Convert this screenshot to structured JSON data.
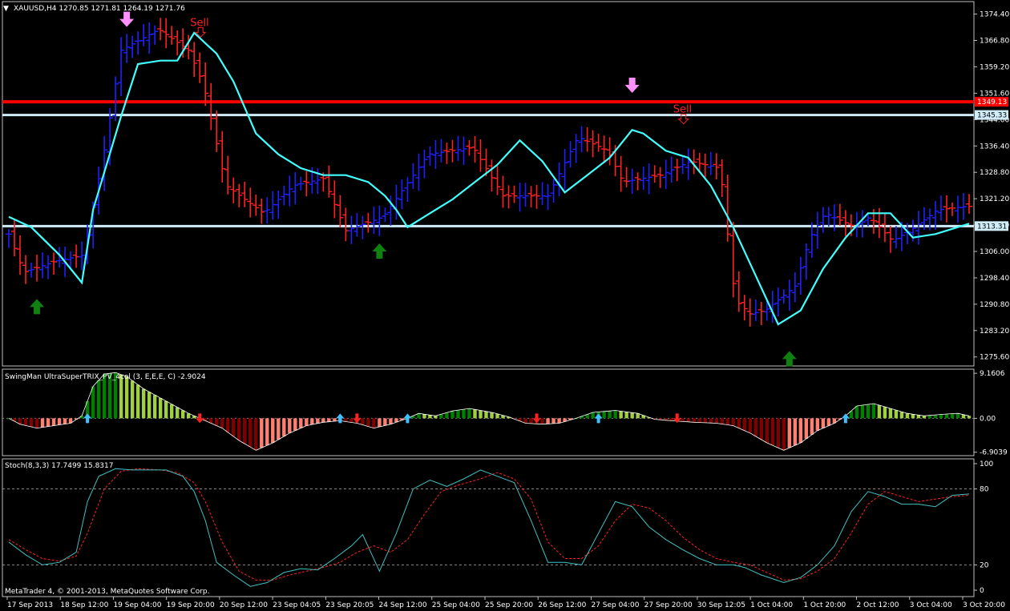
{
  "window": {
    "symbol_line": "XAUUSD,H4  1270.85 1271.81 1264.19 1271.76",
    "menu_glyph": "▼"
  },
  "footer": {
    "copyright": "MetaTrader 4, © 2001-2013, MetaQuotes Software Corp."
  },
  "colors": {
    "background": "#000000",
    "frame": "#c0c0c0",
    "bull_bar": "#2020ff",
    "bear_bar": "#ff2020",
    "signal_line": "#40ffff",
    "resistance_line": "#ff0000",
    "level_line": "#d0ecf8",
    "sell_text": "#ff2020",
    "buy_arrow": "#108010",
    "sell_arrow": "#ff90ff",
    "stoch_main": "#40c0c0",
    "stoch_signal": "#ff2020",
    "hist_strong_up": "#008000",
    "hist_weak_up": "#a0d040",
    "hist_strong_down": "#800000",
    "hist_weak_down": "#ff8070"
  },
  "chart_data": [
    {
      "type": "ohlc",
      "title": "XAUUSD,H4  1270.85 1271.81 1264.19 1271.76",
      "y_ticks": [
        "1374.40",
        "1366.80",
        "1359.20",
        "1351.60",
        "1344.00",
        "1336.40",
        "1328.80",
        "1321.20",
        "1313.60",
        "1306.00",
        "1298.40",
        "1290.80",
        "1283.20",
        "1275.60"
      ],
      "ylim": [
        1273.0,
        1378.0
      ],
      "price_labels": [
        {
          "text": "1349.13",
          "value": 1349.13,
          "color": "#ff0000"
        },
        {
          "text": "1345.33",
          "value": 1345.33,
          "color": "#d0ecf8"
        },
        {
          "text": "1313.31",
          "value": 1313.31,
          "color": "#d0ecf8"
        }
      ],
      "horizontal_lines": [
        {
          "value": 1349.13,
          "kind": "resistance"
        },
        {
          "value": 1345.33,
          "kind": "level"
        },
        {
          "value": 1313.31,
          "kind": "level"
        }
      ],
      "bar_count": 100,
      "pivots": [
        [
          0,
          1311
        ],
        [
          2,
          1300
        ],
        [
          6,
          1303
        ],
        [
          10,
          1305
        ],
        [
          13,
          1338
        ],
        [
          15,
          1364
        ],
        [
          20,
          1370
        ],
        [
          24,
          1364
        ],
        [
          26,
          1354
        ],
        [
          29,
          1325
        ],
        [
          34,
          1317
        ],
        [
          38,
          1325
        ],
        [
          42,
          1327
        ],
        [
          45,
          1312
        ],
        [
          50,
          1316
        ],
        [
          56,
          1334
        ],
        [
          62,
          1336
        ],
        [
          66,
          1322
        ],
        [
          72,
          1322
        ],
        [
          76,
          1339
        ],
        [
          80,
          1335
        ],
        [
          82,
          1326
        ],
        [
          87,
          1328
        ],
        [
          91,
          1332
        ],
        [
          95,
          1330
        ],
        [
          97,
          1292
        ],
        [
          99,
          1288
        ],
        [
          101,
          1289
        ],
        [
          105,
          1296
        ],
        [
          107,
          1310
        ],
        [
          109,
          1317
        ],
        [
          111,
          1315
        ],
        [
          113,
          1313
        ],
        [
          115,
          1316
        ],
        [
          118,
          1309
        ],
        [
          121,
          1313
        ],
        [
          124,
          1318
        ],
        [
          128,
          1319
        ]
      ],
      "signal_line": [
        [
          0,
          1316
        ],
        [
          4,
          1313
        ],
        [
          9,
          1305
        ],
        [
          13,
          1297
        ],
        [
          15,
          1318
        ],
        [
          20,
          1345
        ],
        [
          23,
          1360
        ],
        [
          27,
          1361
        ],
        [
          30,
          1361
        ],
        [
          33,
          1369
        ],
        [
          37,
          1363
        ],
        [
          40,
          1355
        ],
        [
          44,
          1340
        ],
        [
          48,
          1334
        ],
        [
          52,
          1330
        ],
        [
          56,
          1328
        ],
        [
          60,
          1328
        ],
        [
          64,
          1326
        ],
        [
          67,
          1322
        ],
        [
          69,
          1318
        ],
        [
          71,
          1313
        ],
        [
          75,
          1317
        ],
        [
          79,
          1321
        ],
        [
          83,
          1326
        ],
        [
          87,
          1331
        ],
        [
          91,
          1338
        ],
        [
          95,
          1332
        ],
        [
          99,
          1323
        ],
        [
          103,
          1328
        ],
        [
          107,
          1333
        ],
        [
          111,
          1341
        ],
        [
          113,
          1340
        ],
        [
          117,
          1335
        ],
        [
          121,
          1333
        ],
        [
          125,
          1325
        ],
        [
          129,
          1313
        ],
        [
          133,
          1299
        ],
        [
          137,
          1285
        ],
        [
          141,
          1289
        ],
        [
          145,
          1301
        ],
        [
          149,
          1310
        ],
        [
          153,
          1317
        ],
        [
          157,
          1317
        ],
        [
          161,
          1310
        ],
        [
          165,
          1311
        ],
        [
          171,
          1314
        ]
      ],
      "arrows": [
        {
          "dir": "up",
          "x": 5,
          "price": 1290.0,
          "color": "#108010"
        },
        {
          "dir": "down",
          "x": 21,
          "price": 1373.0,
          "color": "#ff90ff"
        },
        {
          "dir": "up",
          "x": 66,
          "price": 1306.0,
          "color": "#108010"
        },
        {
          "dir": "down",
          "x": 111,
          "price": 1354.0,
          "color": "#ff90ff"
        },
        {
          "dir": "up",
          "x": 139,
          "price": 1275.0,
          "color": "#108010"
        }
      ],
      "sell_labels": [
        {
          "text": "Sell",
          "x": 34,
          "price": 1371.0
        },
        {
          "text": "Sell",
          "x": 120,
          "price": 1346.0
        }
      ],
      "x_ticks": [
        "17 Sep 2013",
        "18 Sep 12:00",
        "19 Sep 04:00",
        "19 Sep 20:00",
        "20 Sep 12:00",
        "23 Sep 04:05",
        "23 Sep 20:05",
        "24 Sep 12:00",
        "25 Sep 04:00",
        "25 Sep 20:00",
        "26 Sep 12:00",
        "27 Sep 04:00",
        "27 Sep 20:00",
        "30 Sep 12:05",
        "1 Oct 04:00",
        "1 Oct 20:00",
        "2 Oct 12:00",
        "3 Oct 04:00",
        "3 Oct 20:00"
      ]
    },
    {
      "type": "bar",
      "title": "SwingMan UltraSuperTRIX_PV_4col (3, E,E,E, C) -2.9024",
      "y_ticks": [
        "9.1606",
        "0.00",
        "-6.9039"
      ],
      "ylim": [
        -7.6,
        10.0
      ],
      "shape": [
        [
          0,
          0.0
        ],
        [
          2,
          -1.2
        ],
        [
          5,
          -2.0
        ],
        [
          8,
          -1.5
        ],
        [
          11,
          -1.0
        ],
        [
          13,
          0.5
        ],
        [
          15,
          6.5
        ],
        [
          17,
          9.0
        ],
        [
          19,
          9.3
        ],
        [
          21,
          8.5
        ],
        [
          24,
          6.0
        ],
        [
          28,
          3.5
        ],
        [
          32,
          1.0
        ],
        [
          35,
          -0.5
        ],
        [
          38,
          -2.0
        ],
        [
          41,
          -4.5
        ],
        [
          44,
          -6.5
        ],
        [
          47,
          -5.0
        ],
        [
          50,
          -3.0
        ],
        [
          53,
          -1.5
        ],
        [
          56,
          -0.8
        ],
        [
          59,
          -0.5
        ],
        [
          62,
          -1.0
        ],
        [
          65,
          -2.0
        ],
        [
          68,
          -1.2
        ],
        [
          71,
          0.0
        ],
        [
          73,
          1.0
        ],
        [
          76,
          0.5
        ],
        [
          79,
          1.5
        ],
        [
          82,
          2.0
        ],
        [
          86,
          1.2
        ],
        [
          89,
          0.3
        ],
        [
          92,
          -1.0
        ],
        [
          95,
          -1.2
        ],
        [
          98,
          -1.0
        ],
        [
          101,
          0.0
        ],
        [
          104,
          1.2
        ],
        [
          108,
          1.6
        ],
        [
          112,
          1.0
        ],
        [
          115,
          -0.2
        ],
        [
          118,
          -0.5
        ],
        [
          122,
          -0.8
        ],
        [
          126,
          -1.0
        ],
        [
          129,
          -1.5
        ],
        [
          132,
          -3.0
        ],
        [
          135,
          -5.0
        ],
        [
          138,
          -6.5
        ],
        [
          141,
          -5.0
        ],
        [
          144,
          -2.5
        ],
        [
          147,
          -1.0
        ],
        [
          149,
          0.5
        ],
        [
          151,
          2.5
        ],
        [
          154,
          3.0
        ],
        [
          157,
          2.0
        ],
        [
          160,
          1.0
        ],
        [
          163,
          0.5
        ],
        [
          166,
          0.8
        ],
        [
          169,
          1.0
        ],
        [
          171,
          0.5
        ]
      ],
      "arrows": [
        {
          "dir": "up",
          "x": 14,
          "color": "#40c0ff"
        },
        {
          "dir": "down",
          "x": 34,
          "color": "#ff2020"
        },
        {
          "dir": "up",
          "x": 59,
          "color": "#40c0ff"
        },
        {
          "dir": "down",
          "x": 62,
          "color": "#ff2020"
        },
        {
          "dir": "up",
          "x": 71,
          "color": "#40c0ff"
        },
        {
          "dir": "down",
          "x": 94,
          "color": "#ff2020"
        },
        {
          "dir": "up",
          "x": 105,
          "color": "#40c0ff"
        },
        {
          "dir": "down",
          "x": 119,
          "color": "#ff2020"
        },
        {
          "dir": "up",
          "x": 149,
          "color": "#40c0ff"
        }
      ]
    },
    {
      "type": "line",
      "title": "Stoch(8,3,3) 17.7499 15.8317",
      "y_ticks": [
        "100",
        "80",
        "20",
        "0"
      ],
      "ylim": [
        0,
        100
      ],
      "levels": [
        80,
        20
      ],
      "main": [
        [
          0,
          38
        ],
        [
          3,
          28
        ],
        [
          6,
          20
        ],
        [
          9,
          22
        ],
        [
          12,
          30
        ],
        [
          14,
          70
        ],
        [
          16,
          90
        ],
        [
          19,
          96
        ],
        [
          22,
          95
        ],
        [
          25,
          95
        ],
        [
          28,
          95
        ],
        [
          31,
          90
        ],
        [
          33,
          78
        ],
        [
          35,
          55
        ],
        [
          37,
          22
        ],
        [
          40,
          12
        ],
        [
          43,
          3
        ],
        [
          46,
          6
        ],
        [
          49,
          14
        ],
        [
          52,
          17
        ],
        [
          55,
          16
        ],
        [
          58,
          25
        ],
        [
          61,
          35
        ],
        [
          63,
          44
        ],
        [
          66,
          15
        ],
        [
          69,
          45
        ],
        [
          72,
          80
        ],
        [
          75,
          87
        ],
        [
          78,
          82
        ],
        [
          81,
          88
        ],
        [
          84,
          95
        ],
        [
          87,
          90
        ],
        [
          90,
          85
        ],
        [
          93,
          55
        ],
        [
          96,
          22
        ],
        [
          99,
          22
        ],
        [
          102,
          20
        ],
        [
          105,
          45
        ],
        [
          108,
          70
        ],
        [
          111,
          66
        ],
        [
          114,
          50
        ],
        [
          117,
          40
        ],
        [
          120,
          32
        ],
        [
          123,
          25
        ],
        [
          126,
          20
        ],
        [
          129,
          20
        ],
        [
          131,
          18
        ],
        [
          134,
          12
        ],
        [
          138,
          6
        ],
        [
          141,
          10
        ],
        [
          144,
          20
        ],
        [
          147,
          35
        ],
        [
          150,
          62
        ],
        [
          153,
          78
        ],
        [
          156,
          74
        ],
        [
          159,
          68
        ],
        [
          162,
          68
        ],
        [
          165,
          66
        ],
        [
          168,
          75
        ],
        [
          171,
          76
        ]
      ],
      "signal": [
        [
          0,
          40
        ],
        [
          3,
          32
        ],
        [
          6,
          25
        ],
        [
          9,
          23
        ],
        [
          12,
          27
        ],
        [
          14,
          45
        ],
        [
          17,
          80
        ],
        [
          20,
          94
        ],
        [
          23,
          96
        ],
        [
          27,
          95
        ],
        [
          30,
          93
        ],
        [
          33,
          85
        ],
        [
          35,
          70
        ],
        [
          38,
          38
        ],
        [
          41,
          15
        ],
        [
          44,
          8
        ],
        [
          47,
          8
        ],
        [
          50,
          12
        ],
        [
          53,
          15
        ],
        [
          56,
          18
        ],
        [
          59,
          22
        ],
        [
          62,
          30
        ],
        [
          65,
          35
        ],
        [
          68,
          30
        ],
        [
          71,
          40
        ],
        [
          74,
          60
        ],
        [
          77,
          78
        ],
        [
          80,
          83
        ],
        [
          84,
          88
        ],
        [
          87,
          93
        ],
        [
          90,
          88
        ],
        [
          93,
          72
        ],
        [
          96,
          38
        ],
        [
          99,
          25
        ],
        [
          102,
          25
        ],
        [
          105,
          35
        ],
        [
          108,
          55
        ],
        [
          111,
          68
        ],
        [
          114,
          65
        ],
        [
          117,
          55
        ],
        [
          120,
          42
        ],
        [
          123,
          32
        ],
        [
          126,
          25
        ],
        [
          129,
          22
        ],
        [
          132,
          20
        ],
        [
          135,
          14
        ],
        [
          138,
          8
        ],
        [
          141,
          9
        ],
        [
          144,
          15
        ],
        [
          147,
          25
        ],
        [
          150,
          45
        ],
        [
          153,
          68
        ],
        [
          156,
          78
        ],
        [
          159,
          74
        ],
        [
          162,
          70
        ],
        [
          165,
          72
        ],
        [
          168,
          74
        ],
        [
          171,
          75
        ]
      ]
    }
  ]
}
